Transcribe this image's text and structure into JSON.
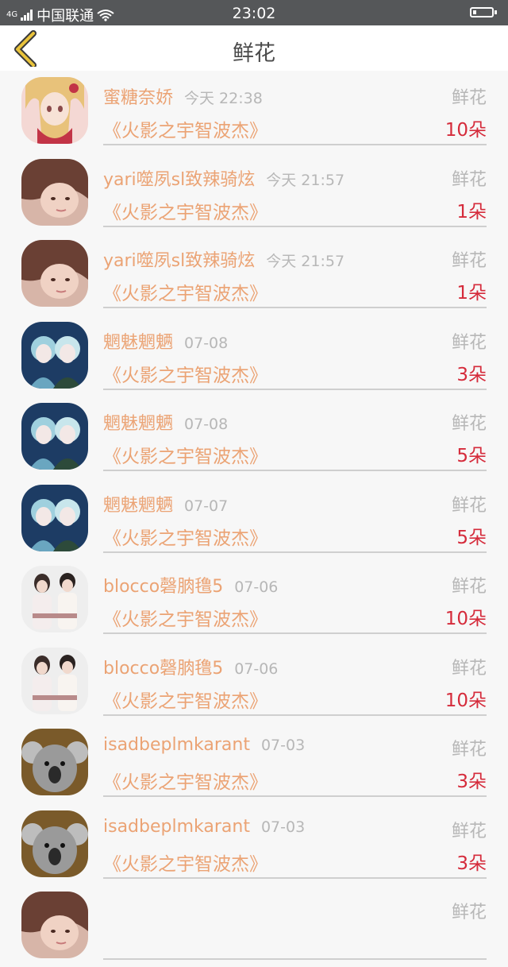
{
  "status_bar": {
    "network": "4G",
    "carrier": "中国联通",
    "time": "23:02"
  },
  "header": {
    "title": "鲜花"
  },
  "records": [
    {
      "name": "蜜糖奈娇",
      "time": "今天 22:38",
      "type": "鲜花",
      "book": "《火影之宇智波杰》",
      "count": "10朵",
      "avatar": "anime-girl-blonde"
    },
    {
      "name": "yari噬夙sl致辣骑炫",
      "time": "今天 21:57",
      "type": "鲜花",
      "book": "《火影之宇智波杰》",
      "count": "1朵",
      "avatar": "girl-photo"
    },
    {
      "name": "yari噬夙sl致辣骑炫",
      "time": "今天 21:57",
      "type": "鲜花",
      "book": "《火影之宇智波杰》",
      "count": "1朵",
      "avatar": "girl-photo"
    },
    {
      "name": "魍魅魍魉",
      "time": "07-08",
      "type": "鲜花",
      "book": "《火影之宇智波杰》",
      "count": "3朵",
      "avatar": "anime-pair-blue"
    },
    {
      "name": "魍魅魍魉",
      "time": "07-08",
      "type": "鲜花",
      "book": "《火影之宇智波杰》",
      "count": "5朵",
      "avatar": "anime-pair-blue"
    },
    {
      "name": "魍魅魍魉",
      "time": "07-07",
      "type": "鲜花",
      "book": "《火影之宇智波杰》",
      "count": "5朵",
      "avatar": "anime-pair-blue"
    },
    {
      "name": "blocco磬朒氇5",
      "time": "07-06",
      "type": "鲜花",
      "book": "《火影之宇智波杰》",
      "count": "10朵",
      "avatar": "couple-photo"
    },
    {
      "name": "blocco磬朒氇5",
      "time": "07-06",
      "type": "鲜花",
      "book": "《火影之宇智波杰》",
      "count": "10朵",
      "avatar": "couple-photo"
    },
    {
      "name": "isadbeplmkarant",
      "time": "07-03",
      "type": "鲜花",
      "book": "《火影之宇智波杰》",
      "count": "3朵",
      "avatar": "koala-photo"
    },
    {
      "name": "isadbeplmkarant",
      "time": "07-03",
      "type": "鲜花",
      "book": "《火影之宇智波杰》",
      "count": "3朵",
      "avatar": "koala-photo"
    },
    {
      "name": "",
      "time": "",
      "type": "鲜花",
      "book": "",
      "count": "",
      "avatar": "girl-photo"
    }
  ],
  "colors": {
    "name": "#eba374",
    "count": "#d52b3b",
    "meta": "#b7b7b7",
    "status_bar": "#555759",
    "back_icon": "#e9c33b"
  }
}
